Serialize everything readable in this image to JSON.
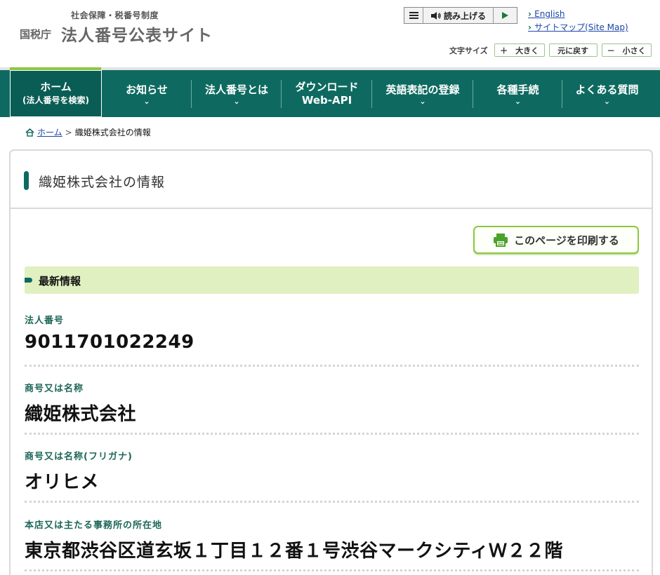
{
  "header": {
    "logo_sub": "社会保障・税番号制度",
    "logo_agency": "国税庁",
    "logo_title": "法人番号公表サイト",
    "read_aloud_label": "読み上げる",
    "links": [
      {
        "label": "English"
      },
      {
        "label": "サイトマップ(Site Map)"
      }
    ],
    "font_size": {
      "label": "文字サイズ",
      "larger": "＋　大きく",
      "reset": "元に戻す",
      "smaller": "－　小さく"
    }
  },
  "nav": {
    "items": [
      {
        "label": "ホーム",
        "sub": "(法人番号を検索)"
      },
      {
        "label": "お知らせ"
      },
      {
        "label": "法人番号とは"
      },
      {
        "label": "ダウンロード",
        "sub": "Web-API"
      },
      {
        "label": "英語表記の登録"
      },
      {
        "label": "各種手続"
      },
      {
        "label": "よくある質問"
      }
    ]
  },
  "breadcrumb": {
    "home": "ホーム",
    "current": "織姫株式会社の情報"
  },
  "main": {
    "title": "織姫株式会社の情報",
    "print_label": "このページを印刷する",
    "section_label": "最新情報",
    "fields": [
      {
        "label": "法人番号",
        "value": "9011701022249"
      },
      {
        "label": "商号又は名称",
        "value": "織姫株式会社"
      },
      {
        "label": "商号又は名称(フリガナ)",
        "value": "オリヒメ"
      },
      {
        "label": "本店又は主たる事務所の所在地",
        "value": "東京都渋谷区道玄坂１丁目１２番１号渋谷マークシティＷ２２階"
      }
    ]
  },
  "colors": {
    "nav_bg": "#0e6a60",
    "accent_green": "#8cc63f",
    "section_bg": "#e0f0c0",
    "label_teal": "#1d6658"
  }
}
